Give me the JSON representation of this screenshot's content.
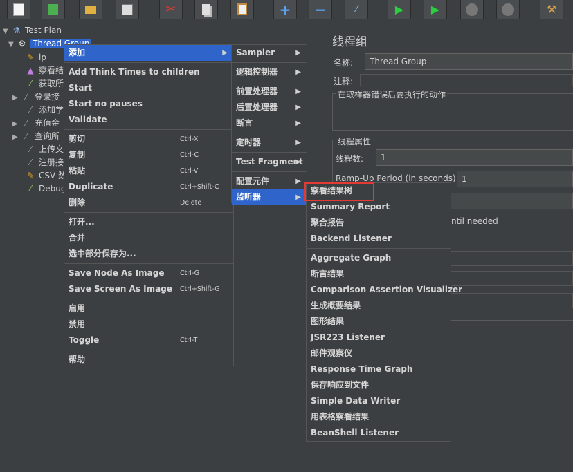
{
  "toolbar": {
    "buttons": [
      {
        "name": "new-icon",
        "glyph": "🗋"
      },
      {
        "name": "templates-icon",
        "glyph": "📗"
      },
      {
        "name": "open-icon",
        "glyph": "📂"
      },
      {
        "name": "save-icon",
        "glyph": "💾"
      },
      {
        "name": "cut-icon",
        "glyph": "✂"
      },
      {
        "name": "copy-icon",
        "glyph": "📄"
      },
      {
        "name": "paste-icon",
        "glyph": "📋"
      },
      {
        "name": "expand-icon",
        "glyph": "+"
      },
      {
        "name": "collapse-icon",
        "glyph": "−"
      },
      {
        "name": "toggle-icon",
        "glyph": "⚡"
      },
      {
        "name": "start-icon",
        "glyph": "▶"
      },
      {
        "name": "start-no-pause-icon",
        "glyph": "▶"
      },
      {
        "name": "stop-icon",
        "glyph": "■"
      },
      {
        "name": "shutdown-icon",
        "glyph": "✖"
      },
      {
        "name": "clear-icon",
        "glyph": "🧹"
      }
    ]
  },
  "tree": {
    "test_plan": "Test Plan",
    "thread_group": "Thread Group",
    "items": [
      "ip",
      "察看结",
      "获取所",
      "登录接",
      "添加学",
      "充值金",
      "查询所",
      "上传文",
      "注册接",
      "CSV 数",
      "Debug"
    ]
  },
  "right_panel": {
    "title": "线程组",
    "name_label": "名称:",
    "name_value": "Thread Group",
    "comment_label": "注释:",
    "error_action_label": "在取样器错误后要执行的动作",
    "thread_props_label": "线程属性",
    "threads_label": "线程数:",
    "threads_value": "1",
    "rampup_label": "Ramp-Up Period (in seconds):",
    "rampup_value": "1",
    "needed_text": "ntil needed"
  },
  "context_menu": {
    "add": "添加",
    "add_think_times": "Add Think Times to children",
    "start": "Start",
    "start_no_pauses": "Start no pauses",
    "validate": "Validate",
    "cut": "剪切",
    "cut_sc": "Ctrl-X",
    "copy": "复制",
    "copy_sc": "Ctrl-C",
    "paste": "粘贴",
    "paste_sc": "Ctrl-V",
    "duplicate": "Duplicate",
    "duplicate_sc": "Ctrl+Shift-C",
    "delete": "删除",
    "delete_sc": "Delete",
    "open": "打开...",
    "merge": "合并",
    "save_selection": "选中部分保存为...",
    "save_node_image": "Save Node As Image",
    "save_node_image_sc": "Ctrl-G",
    "save_screen_image": "Save Screen As Image",
    "save_screen_image_sc": "Ctrl+Shift-G",
    "enable": "启用",
    "disable": "禁用",
    "toggle": "Toggle",
    "toggle_sc": "Ctrl-T",
    "help": "帮助"
  },
  "add_submenu": {
    "sampler": "Sampler",
    "logic_controller": "逻辑控制器",
    "pre_processor": "前置处理器",
    "post_processor": "后置处理器",
    "assertion": "断言",
    "timer": "定时器",
    "test_fragment": "Test Fragment",
    "config_element": "配置元件",
    "listener": "监听器"
  },
  "listener_submenu": {
    "view_results_tree": "察看结果树",
    "summary_report": "Summary Report",
    "aggregate_report": "聚合报告",
    "backend_listener": "Backend Listener",
    "aggregate_graph": "Aggregate Graph",
    "assertion_results": "断言结果",
    "comparison_assertion_visualizer": "Comparison Assertion Visualizer",
    "generate_summary_results": "生成概要结果",
    "graph_results": "图形结果",
    "jsr223_listener": "JSR223 Listener",
    "mailer_visualizer": "邮件观察仪",
    "response_time_graph": "Response Time Graph",
    "save_responses_to_file": "保存响应到文件",
    "simple_data_writer": "Simple Data Writer",
    "view_results_in_table": "用表格察看结果",
    "beanshell_listener": "BeanShell Listener"
  }
}
